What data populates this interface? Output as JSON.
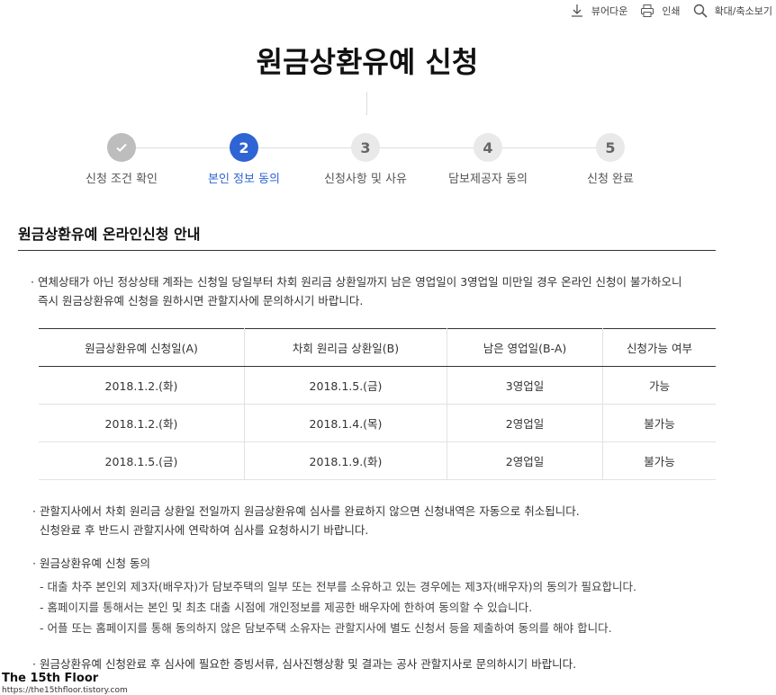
{
  "toolbar": {
    "viewer_label": "뷰어다운",
    "print_label": "인쇄",
    "zoom_label": "확대/축소보기"
  },
  "page_title": "원금상환유예 신청",
  "steps": [
    {
      "number": "",
      "label": "신청 조건 확인",
      "state": "done"
    },
    {
      "number": "2",
      "label": "본인 정보 동의",
      "state": "active"
    },
    {
      "number": "3",
      "label": "신청사항 및 사유",
      "state": "todo"
    },
    {
      "number": "4",
      "label": "담보제공자 동의",
      "state": "todo"
    },
    {
      "number": "5",
      "label": "신청 완료",
      "state": "todo"
    }
  ],
  "section_title": "원금상환유예 온라인신청 안내",
  "notice1": {
    "line1": "연체상태가 아닌 정상상태 계좌는 신청일 당일부터 차회 원리금 상환일까지 남은 영업일이 3영업일 미만일 경우 온라인 신청이 불가하오니",
    "line2": "즉시 원금상환유예 신청을 원하시면 관할지사에 문의하시기 바랍니다."
  },
  "table": {
    "headers": [
      "원금상환유예 신청일(A)",
      "차회 원리금 상환일(B)",
      "남은 영업일(B-A)",
      "신청가능 여부"
    ],
    "rows": [
      [
        "2018.1.2.(화)",
        "2018.1.5.(금)",
        "3영업일",
        "가능"
      ],
      [
        "2018.1.2.(화)",
        "2018.1.4.(목)",
        "2영업일",
        "불가능"
      ],
      [
        "2018.1.5.(금)",
        "2018.1.9.(화)",
        "2영업일",
        "불가능"
      ]
    ]
  },
  "notice2": {
    "line1": "관할지사에서 차회 원리금 상환일 전일까지 원금상환유예 심사를 완료하지 않으면 신청내역은 자동으로 취소됩니다.",
    "line2": "신청완료 후 반드시 관할지사에 연락하여 심사를 요청하시기 바랍니다."
  },
  "consent": {
    "title": "원금상환유예 신청 동의",
    "items": [
      "- 대출 차주 본인외 제3자(배우자)가 담보주택의 일부 또는 전부를 소유하고 있는 경우에는 제3자(배우자)의 동의가 필요합니다.",
      "- 홈페이지를 통해서는 본인 및 최초 대출 시점에 개인정보를 제공한 배우자에 한하여 동의할 수 있습니다.",
      "- 어플 또는 홈페이지를 통해 동의하지 않은 담보주택 소유자는 관할지사에 별도 신청서 등을 제출하여 동의를 해야 합니다."
    ]
  },
  "notice3": "원금상환유예 신청완료 후 심사에 필요한 증빙서류, 심사진행상황 및 결과는 공사 관할지사로 문의하시기 바랍니다.",
  "watermark": {
    "title": "The 15th Floor",
    "url": "https://the15thfloor.tistory.com"
  },
  "colors": {
    "accent": "#2f64d4",
    "link": "#2f4fb5"
  }
}
